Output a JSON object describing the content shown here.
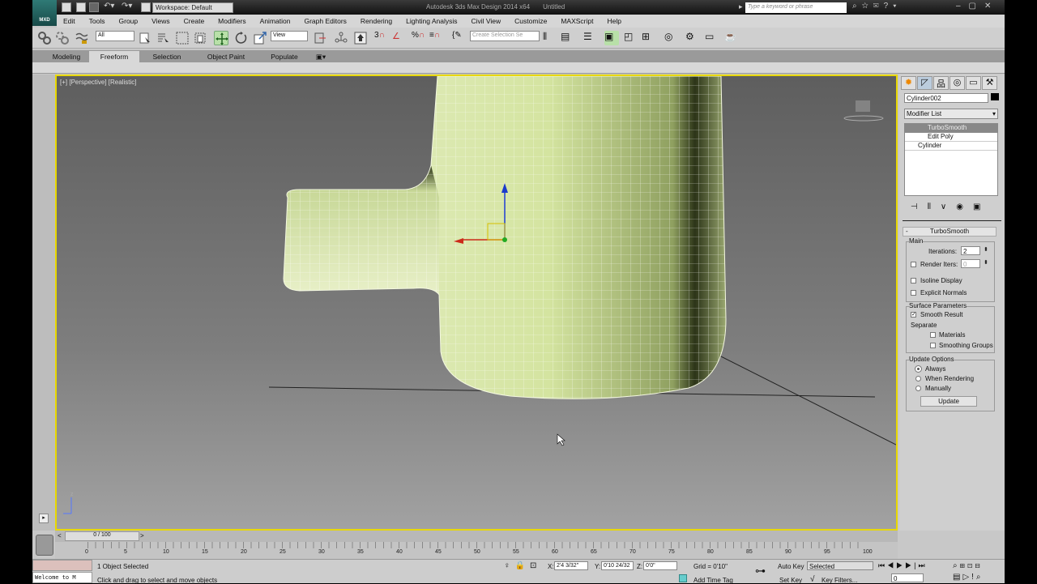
{
  "titlebar": {
    "app_title": "Autodesk 3ds Max Design 2014 x64",
    "doc_title": "Untitled",
    "workspace": "Workspace: Default",
    "search_placeholder": "Type a keyword or phrase",
    "logo": "MXD"
  },
  "menu": [
    "Edit",
    "Tools",
    "Group",
    "Views",
    "Create",
    "Modifiers",
    "Animation",
    "Graph Editors",
    "Rendering",
    "Lighting Analysis",
    "Civil View",
    "Customize",
    "MAXScript",
    "Help"
  ],
  "toolbar": {
    "selection_filter": "All",
    "ref_coord": "View",
    "snap_angle": "3",
    "named_selection_placeholder": "Create Selection Se"
  },
  "ribbon": {
    "tabs": [
      "Modeling",
      "Freeform",
      "Selection",
      "Object Paint",
      "Populate"
    ],
    "active": "Freeform"
  },
  "viewport": {
    "label": "[+] [Perspective] [Realistic]",
    "axis_label": "z"
  },
  "command_panel": {
    "object_name": "Cylinder002",
    "modifier_list": "Modifier List",
    "stack": [
      "TurboSmooth",
      "Edit Poly",
      "Cylinder"
    ],
    "rollout_title": "TurboSmooth",
    "minus": "-",
    "main": {
      "group": "Main",
      "iterations_label": "Iterations:",
      "iterations": "2",
      "render_iters_label": "Render Iters:",
      "render_iters": "0",
      "render_iters_checked": false,
      "isoline_label": "Isoline Display",
      "isoline_checked": false,
      "explicit_normals_label": "Explicit Normals",
      "explicit_checked": false
    },
    "surface": {
      "group": "Surface Parameters",
      "smooth_result_label": "Smooth Result",
      "smooth_checked": true,
      "separate_label": "Separate",
      "materials_label": "Materials",
      "smoothing_groups_label": "Smoothing Groups"
    },
    "update": {
      "group": "Update Options",
      "always": "Always",
      "when_rendering": "When Rendering",
      "manually": "Manually",
      "selected": "Always",
      "button": "Update"
    }
  },
  "timeline": {
    "frame": "0 / 100",
    "prev": "<",
    "next": ">",
    "ticks": [
      "0",
      "5",
      "10",
      "15",
      "20",
      "25",
      "30",
      "35",
      "40",
      "45",
      "50",
      "55",
      "60",
      "65",
      "70",
      "75",
      "80",
      "85",
      "90",
      "95",
      "100"
    ]
  },
  "status": {
    "maxscript": "Welcome to M",
    "selection": "1 Object Selected",
    "prompt": "Click and drag to select and move objects",
    "x_label": "X:",
    "x": "2'4 3/32\"",
    "y_label": "Y:",
    "y": "0'10 24/32",
    "z_label": "Z:",
    "z": "0'0\"",
    "grid": "Grid = 0'10\"",
    "add_time_tag": "Add Time Tag",
    "auto_key": "Auto Key",
    "set_key": "Set Key",
    "key_mode": "Selected",
    "key_filters": "Key Filters...",
    "current_frame": "0"
  }
}
